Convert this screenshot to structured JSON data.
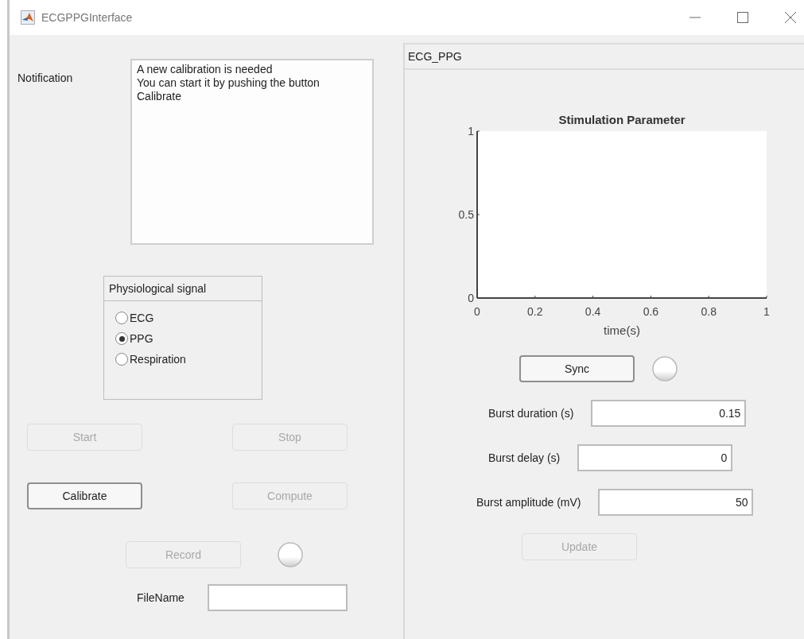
{
  "window": {
    "title": "ECGPPGInterface"
  },
  "notification": {
    "label": "Notification",
    "text": "A new calibration is needed\nYou can start it by pushing the button\nCalibrate"
  },
  "signal_group": {
    "title": "Physiological signal",
    "options": [
      {
        "label": "ECG",
        "selected": false
      },
      {
        "label": "PPG",
        "selected": true
      },
      {
        "label": "Respiration",
        "selected": false
      }
    ]
  },
  "control_buttons": [
    {
      "label": "Start",
      "disabled": true
    },
    {
      "label": "Stop",
      "disabled": true
    },
    {
      "label": "Calibrate",
      "disabled": false
    },
    {
      "label": "Compute",
      "disabled": true
    }
  ],
  "record": {
    "label": "Record",
    "disabled": true
  },
  "file_name": {
    "label": "FileName"
  },
  "panel": {
    "title": "ECG_PPG",
    "chart_data": {
      "type": "line",
      "title": "Stimulation Parameter",
      "xlabel": "time(s)",
      "xlim": [
        0,
        1
      ],
      "ylim": [
        0,
        1
      ],
      "xticks": [
        0,
        0.2,
        0.4,
        0.6,
        0.8,
        1
      ],
      "yticks": [
        0,
        0.5,
        1
      ]
    },
    "sync": {
      "label": "Sync",
      "disabled": false
    },
    "parameters": [
      {
        "label": "Burst duration (s)",
        "value": "0.15"
      },
      {
        "label": "Burst delay (s)",
        "value": "0"
      },
      {
        "label": "Burst amplitude (mV)",
        "value": "50"
      }
    ],
    "update": {
      "label": "Update",
      "disabled": true
    }
  }
}
